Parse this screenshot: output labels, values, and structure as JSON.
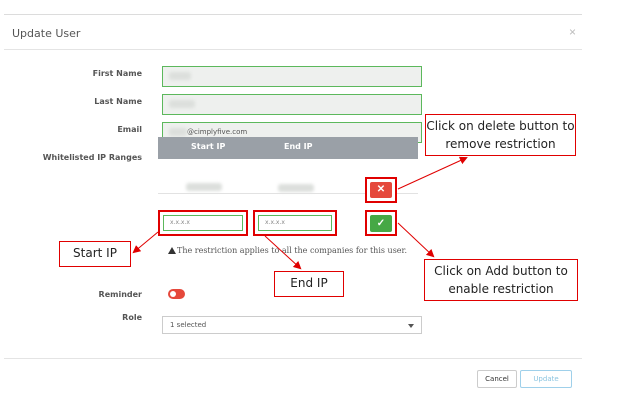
{
  "modal": {
    "title": "Update User",
    "close_glyph": "×"
  },
  "form": {
    "first_name_label": "First Name",
    "last_name_label": "Last Name",
    "email_label": "Email",
    "email_value_suffix": "@cimplyfive.com",
    "whitelisted_label": "Whitelisted IP Ranges",
    "ip_table": {
      "start_ip_header": "Start IP",
      "end_ip_header": "End IP"
    },
    "start_ip_placeholder": "x.x.x.x",
    "end_ip_placeholder": "x.x.x.x",
    "delete_glyph": "✕",
    "add_glyph": "✓",
    "note": "The restriction applies to all the companies for this user.",
    "reminder_label": "Reminder",
    "role_label": "Role",
    "role_value": "1 selected"
  },
  "footer": {
    "cancel_label": "Cancel",
    "update_label": "Update"
  },
  "callouts": {
    "delete": "Click on delete button to remove restriction",
    "start_ip": "Start IP",
    "end_ip": "End IP",
    "add": "Click on Add button to enable restriction"
  },
  "colors": {
    "field_border": "#5cb85c",
    "delete_button": "#e5483b",
    "add_button": "#46a845",
    "annotation_red": "#e00000",
    "table_header": "#9aa0a7"
  },
  "icons": {
    "close": "close-icon",
    "warning": "warning-icon",
    "delete": "x-icon",
    "add": "check-icon",
    "dropdown": "chevron-down-icon"
  },
  "state": {
    "reminder_enabled": false
  }
}
